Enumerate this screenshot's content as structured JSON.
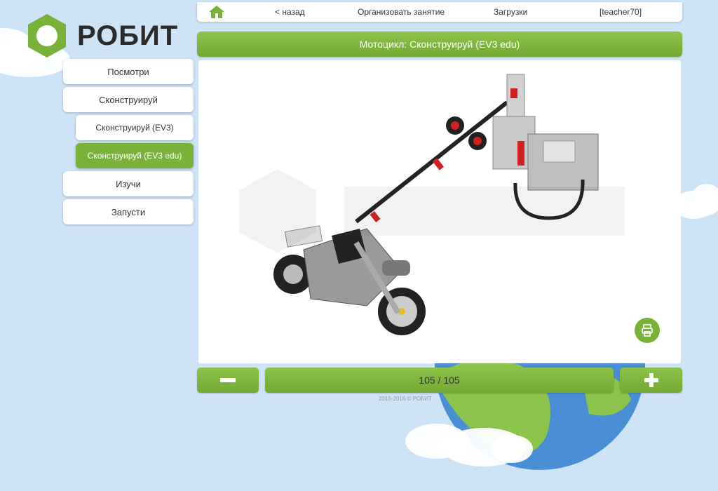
{
  "brand": {
    "name": "РОБИТ",
    "accent": "#7ab13a"
  },
  "topnav": {
    "back_label": "< назад",
    "organize_label": "Организовать занятие",
    "downloads_label": "Загрузки",
    "user_label": "[teacher70]"
  },
  "sidebar": {
    "items": [
      {
        "label": "Посмотри"
      },
      {
        "label": "Сконструируй"
      },
      {
        "label": "Сконструируй (EV3)"
      },
      {
        "label": "Сконструируй (EV3 edu)"
      },
      {
        "label": "Изучи"
      },
      {
        "label": "Запусти"
      }
    ]
  },
  "page": {
    "title": "Мотоцикл: Сконструируй (EV3 edu)"
  },
  "pager": {
    "current": "105 / 105"
  },
  "footer": {
    "text": "2015-2016 © РОБИТ"
  },
  "icons": {
    "home": "home-icon",
    "print": "print-icon",
    "minus": "minus-icon",
    "plus": "plus-icon"
  }
}
